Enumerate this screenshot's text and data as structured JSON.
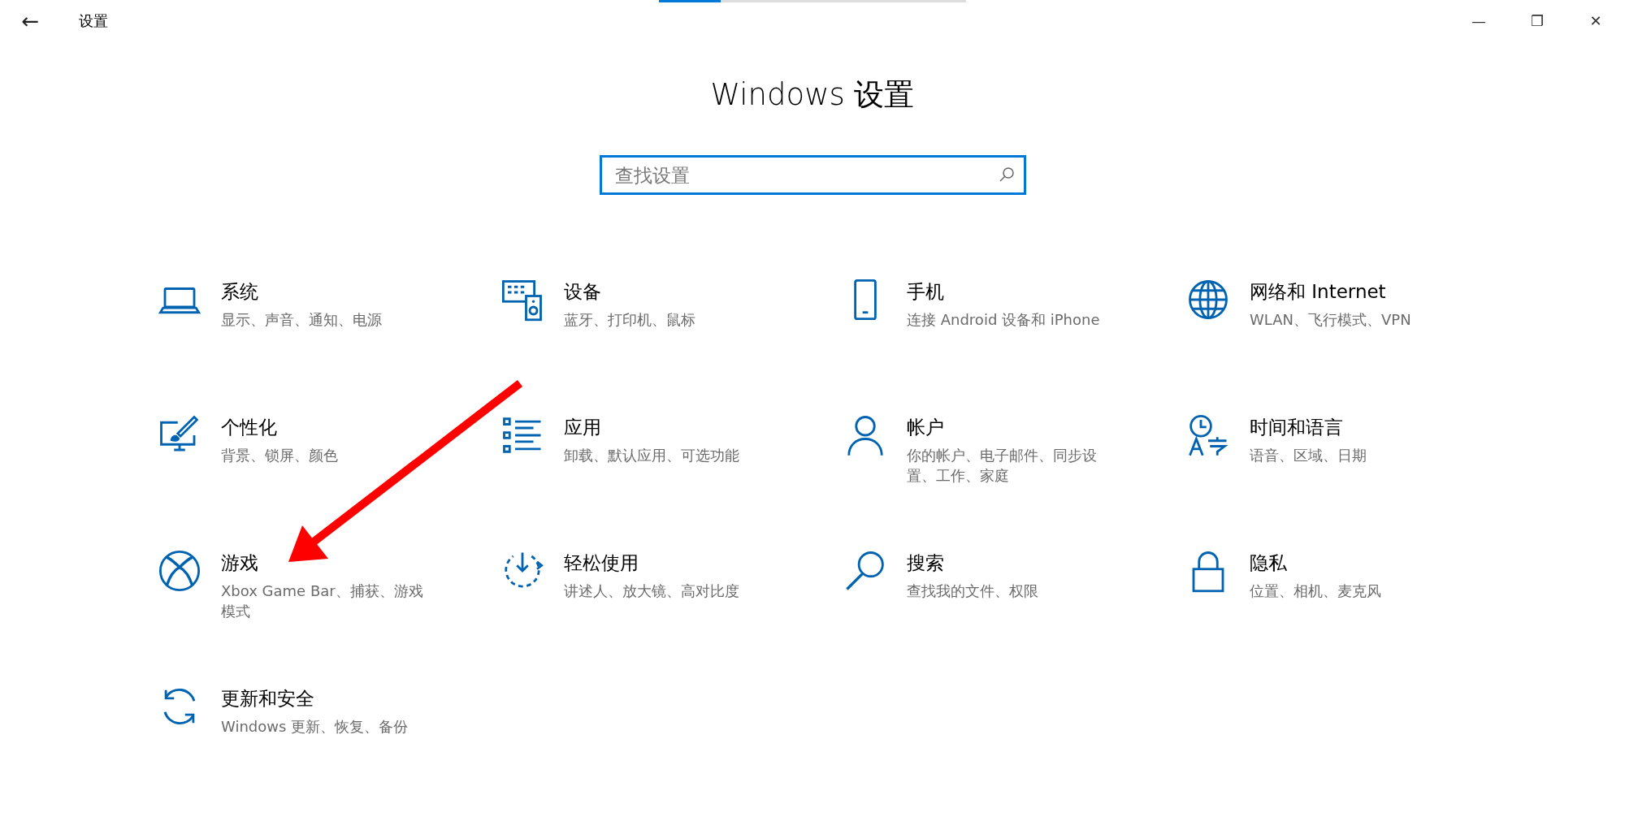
{
  "window": {
    "title": "设置",
    "back": "←",
    "controls": [
      "—",
      "❐",
      "✕"
    ]
  },
  "loading_bar": {
    "level": 0.2
  },
  "heading": "Windows 设置",
  "search": {
    "placeholder": "查找设置"
  },
  "categories": [
    {
      "kind": "laptop",
      "title": "系统",
      "subtitle": "显示、声音、通知、电源"
    },
    {
      "kind": "devices",
      "title": "设备",
      "subtitle": "蓝牙、打印机、鼠标"
    },
    {
      "kind": "phone",
      "title": "手机",
      "subtitle": "连接 Android 设备和 iPhone"
    },
    {
      "kind": "globe",
      "title": "网络和 Internet",
      "subtitle": "WLAN、飞行模式、VPN"
    },
    {
      "kind": "paint",
      "title": "个性化",
      "subtitle": "背景、锁屏、颜色"
    },
    {
      "kind": "apps",
      "title": "应用",
      "subtitle": "卸载、默认应用、可选功能"
    },
    {
      "kind": "person",
      "title": "帐户",
      "subtitle": "你的帐户、电子邮件、同步设置、工作、家庭"
    },
    {
      "kind": "language",
      "title": "时间和语言",
      "subtitle": "语音、区域、日期"
    },
    {
      "kind": "xbox",
      "title": "游戏",
      "subtitle": "Xbox Game Bar、捕获、游戏模式"
    },
    {
      "kind": "ease",
      "title": "轻松使用",
      "subtitle": "讲述人、放大镜、高对比度"
    },
    {
      "kind": "search",
      "title": "搜索",
      "subtitle": "查找我的文件、权限"
    },
    {
      "kind": "lock",
      "title": "隐私",
      "subtitle": "位置、相机、麦克风"
    },
    {
      "kind": "sync",
      "title": "更新和安全",
      "subtitle": "Windows 更新、恢复、备份"
    }
  ],
  "annotation": {
    "kind": "arrow"
  }
}
